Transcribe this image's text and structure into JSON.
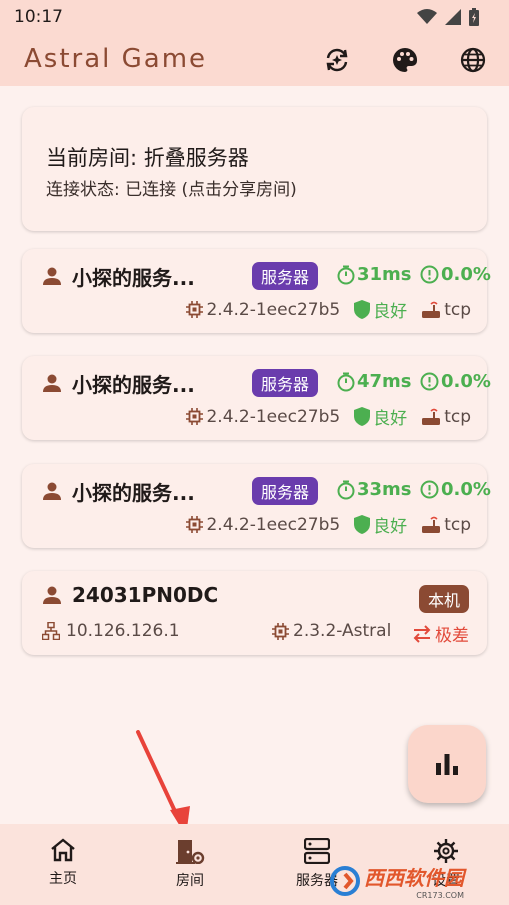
{
  "statusbar": {
    "time": "10:17"
  },
  "appbar": {
    "title": "Astral Game"
  },
  "room": {
    "line1": "当前房间: 折叠服务器",
    "line2": "连接状态: 已连接 (点击分享房间)"
  },
  "peers": [
    {
      "name": "小探的服务...",
      "badge": "服务器",
      "ping": "31ms",
      "loss": "0.0%",
      "version": "2.4.2-1eec27b5",
      "quality": "良好",
      "protocol": "tcp"
    },
    {
      "name": "小探的服务...",
      "badge": "服务器",
      "ping": "47ms",
      "loss": "0.0%",
      "version": "2.4.2-1eec27b5",
      "quality": "良好",
      "protocol": "tcp"
    },
    {
      "name": "小探的服务...",
      "badge": "服务器",
      "ping": "33ms",
      "loss": "0.0%",
      "version": "2.4.2-1eec27b5",
      "quality": "良好",
      "protocol": "tcp"
    }
  ],
  "local": {
    "name": "24031PN0DC",
    "badge": "本机",
    "ip": "10.126.126.1",
    "version": "2.3.2-Astral",
    "quality": "极差"
  },
  "nav": {
    "home": "主页",
    "room": "房间",
    "server": "服务器",
    "settings": "设置"
  },
  "watermark": {
    "text": "西西软件园",
    "sub": "CR173.COM"
  },
  "colors": {
    "accent": "#8b4a33",
    "badge": "#6a3cad",
    "good": "#4caf50",
    "bad": "#e24a3b"
  }
}
